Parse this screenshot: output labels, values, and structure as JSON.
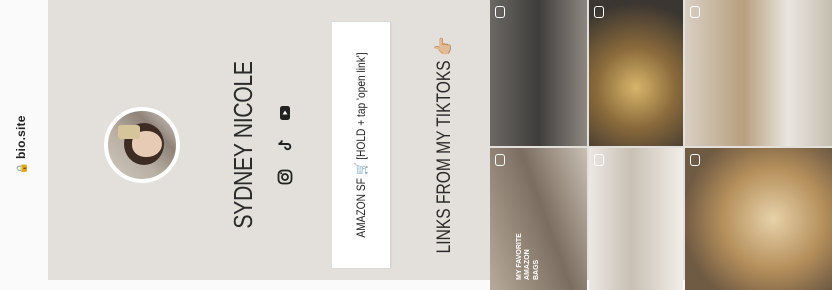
{
  "header": {
    "logo": "bio.site"
  },
  "profile": {
    "name": "SYDNEY NICOLE"
  },
  "socials": [
    {
      "icon": "instagram-icon"
    },
    {
      "icon": "tiktok-icon"
    },
    {
      "icon": "youtube-icon"
    }
  ],
  "links": [
    {
      "label": "AMAZON SF 🛒 [HOLD + tap 'open link']"
    }
  ],
  "section": {
    "title": "LINKS FROM MY TIKTOKS 👉🏼"
  },
  "tiles": [
    {
      "caption": "MY FAVORITE AMAZON BAGS"
    },
    {
      "caption": ""
    },
    {
      "caption": ""
    },
    {
      "caption": ""
    },
    {
      "caption": ""
    },
    {
      "caption": ""
    }
  ]
}
